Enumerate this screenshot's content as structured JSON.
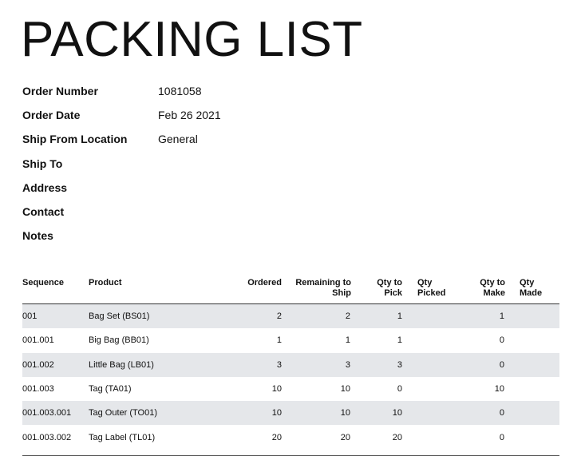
{
  "title": "PACKING LIST",
  "meta": [
    {
      "label": "Order Number",
      "value": "1081058"
    },
    {
      "label": "Order Date",
      "value": "Feb 26 2021"
    },
    {
      "label": "Ship From Location",
      "value": "General"
    },
    {
      "label": "Ship To",
      "value": ""
    },
    {
      "label": "Address",
      "value": ""
    },
    {
      "label": "Contact",
      "value": ""
    },
    {
      "label": "Notes",
      "value": ""
    }
  ],
  "table": {
    "headers": {
      "sequence": "Sequence",
      "product": "Product",
      "ordered": "Ordered",
      "remaining": "Remaining to\nShip",
      "qty_to_pick": "Qty to\nPick",
      "qty_picked": "Qty\nPicked",
      "qty_to_make": "Qty to\nMake",
      "qty_made": "Qty\nMade"
    },
    "rows": [
      {
        "sequence": "001",
        "product": "Bag Set (BS01)",
        "ordered": "2",
        "remaining": "2",
        "qty_to_pick": "1",
        "qty_picked": "",
        "qty_to_make": "1",
        "qty_made": ""
      },
      {
        "sequence": "001.001",
        "product": "Big Bag (BB01)",
        "ordered": "1",
        "remaining": "1",
        "qty_to_pick": "1",
        "qty_picked": "",
        "qty_to_make": "0",
        "qty_made": ""
      },
      {
        "sequence": "001.002",
        "product": "Little Bag (LB01)",
        "ordered": "3",
        "remaining": "3",
        "qty_to_pick": "3",
        "qty_picked": "",
        "qty_to_make": "0",
        "qty_made": ""
      },
      {
        "sequence": "001.003",
        "product": "Tag (TA01)",
        "ordered": "10",
        "remaining": "10",
        "qty_to_pick": "0",
        "qty_picked": "",
        "qty_to_make": "10",
        "qty_made": ""
      },
      {
        "sequence": "001.003.001",
        "product": "Tag Outer (TO01)",
        "ordered": "10",
        "remaining": "10",
        "qty_to_pick": "10",
        "qty_picked": "",
        "qty_to_make": "0",
        "qty_made": ""
      },
      {
        "sequence": "001.003.002",
        "product": "Tag Label (TL01)",
        "ordered": "20",
        "remaining": "20",
        "qty_to_pick": "20",
        "qty_picked": "",
        "qty_to_make": "0",
        "qty_made": ""
      }
    ]
  },
  "colors": {
    "row_shade": "#e5e7ea",
    "rule": "#333333"
  }
}
